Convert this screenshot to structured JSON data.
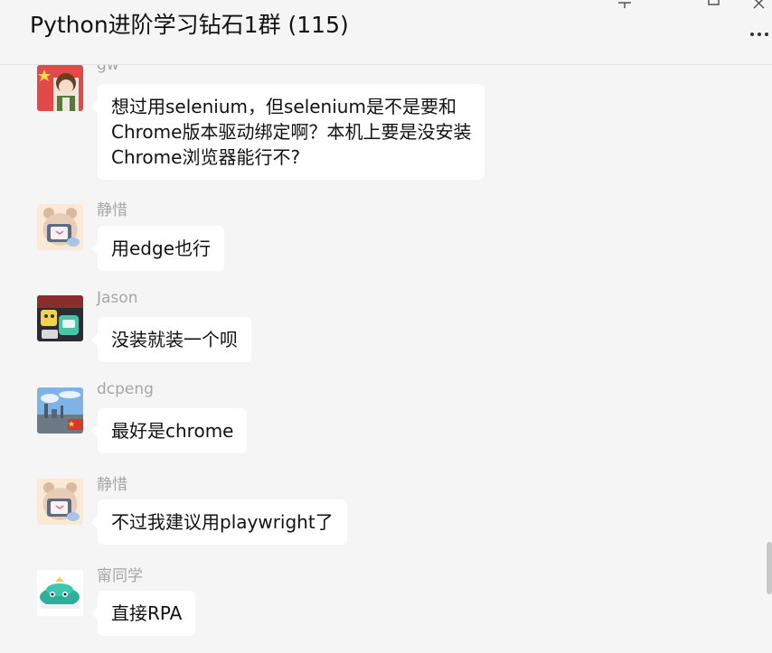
{
  "header": {
    "title": "Python进阶学习钻石1群 (115)"
  },
  "window_controls": {
    "pin_icon": "pin-icon",
    "maximize_icon": "maximize-icon",
    "close_icon": "close-icon",
    "more_icon": "more-icon"
  },
  "messages": [
    {
      "sender": "gw",
      "text": "想过用selenium，但selenium是不是要和\nChrome版本驱动绑定啊？本机上要是没安装\nChrome浏览器能行不?"
    },
    {
      "sender": "静惜",
      "text": "用edge也行"
    },
    {
      "sender": "Jason",
      "text": "没装就装一个呗"
    },
    {
      "sender": "dcpeng",
      "text": "最好是chrome"
    },
    {
      "sender": "静惜",
      "text": "不过我建议用playwright了"
    },
    {
      "sender": "甯同学",
      "text": "直接RPA"
    }
  ]
}
